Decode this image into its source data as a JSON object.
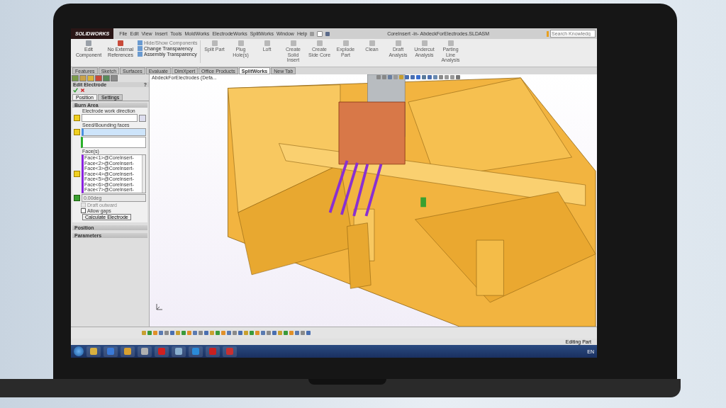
{
  "window": {
    "logo": "SOLIDWORKS",
    "title": "CoreInsert -in- AbdeckForElectrodes.SLDASM",
    "search": {
      "placeholder": "Search Knowledg"
    }
  },
  "menu": [
    "File",
    "Edit",
    "View",
    "Insert",
    "Tools",
    "MoldWorks",
    "ElectrodeWorks",
    "SplitWorks",
    "Window",
    "Help"
  ],
  "ribbon": {
    "large": [
      {
        "label": "Edit Component"
      },
      {
        "label": "No External References"
      }
    ],
    "small": [
      "Hide/Show Components",
      "Change Transparency",
      "Assembly Transparency"
    ],
    "tools": [
      {
        "label": "Split Part"
      },
      {
        "label": "Plug Hole(s)"
      },
      {
        "label": "Loft"
      },
      {
        "label": "Create Solid Insert"
      },
      {
        "label": "Create Side Core"
      },
      {
        "label": "Explode Part"
      },
      {
        "label": "Clean"
      },
      {
        "label": "Draft Analysis"
      },
      {
        "label": "Undercut Analysis"
      },
      {
        "label": "Parting Line Analysis"
      }
    ]
  },
  "command_tabs": [
    {
      "label": "Features",
      "selected": false
    },
    {
      "label": "Sketch",
      "selected": false
    },
    {
      "label": "Surfaces",
      "selected": false
    },
    {
      "label": "Evaluate",
      "selected": false
    },
    {
      "label": "DimXpert",
      "selected": false
    },
    {
      "label": "Office Products",
      "selected": false
    },
    {
      "label": "SplitWorks",
      "selected": true
    },
    {
      "label": "New Tab",
      "selected": false
    }
  ],
  "property_manager": {
    "title": "Edit Electrode",
    "help": "?",
    "tabs": [
      {
        "label": "Position",
        "selected": true
      },
      {
        "label": "Settings",
        "selected": false
      }
    ],
    "burn_area": {
      "title": "Burn Area",
      "direction_label": "Electrode work direction",
      "seed_label": "Seed/Bounding faces",
      "faces_label": "Face(s)",
      "faces": [
        "Face<1>@CoreInsert-",
        "Face<2>@CoreInsert-",
        "Face<3>@CoreInsert-",
        "Face<4>@CoreInsert-",
        "Face<5>@CoreInsert-",
        "Face<6>@CoreInsert-",
        "Face<7>@CoreInsert-"
      ],
      "angle": "0.00deg",
      "options": [
        {
          "label": "Draft outward",
          "checked": false,
          "disabled": true
        },
        {
          "label": "Allow gaps",
          "checked": false,
          "disabled": false
        }
      ],
      "button": "Calculate Electrode"
    },
    "collapsed_sections": [
      "Position",
      "Parameters"
    ]
  },
  "tree": {
    "root": "AbdeckForElectrodes (Defa..."
  },
  "status_bar": {
    "text": "Editing Part"
  },
  "taskbar": {
    "language": "EN"
  }
}
